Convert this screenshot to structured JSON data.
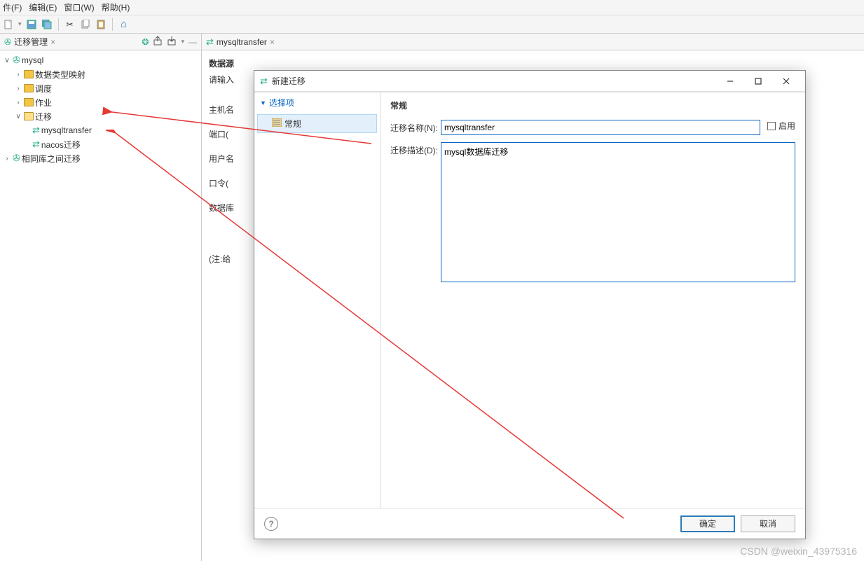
{
  "menubar": {
    "file": "件(F)",
    "edit": "编辑(E)",
    "window": "窗口(W)",
    "help": "帮助(H)"
  },
  "left_panel": {
    "tab_title": "迁移管理",
    "tree": {
      "root": "mysql",
      "items": [
        "数据类型映射",
        "调度",
        "作业",
        "迁移"
      ],
      "migration_children": [
        "mysqltransfer",
        "nacos迁移"
      ],
      "sibling": "相同库之间迁移"
    }
  },
  "editor": {
    "tab_title": "mysqltransfer",
    "section": "数据源",
    "prompt": "请输入",
    "labels": {
      "host": "主机名",
      "port": "端口(",
      "user": "用户名",
      "pass": "口令(",
      "db": "数据库",
      "note": "(注:给"
    }
  },
  "dialog": {
    "title": "新建迁移",
    "left": {
      "header": "选择项",
      "item": "常规"
    },
    "right": {
      "title": "常规",
      "name_label": "迁移名称(N):",
      "name_value": "mysqltransfer",
      "enable_label": "启用",
      "desc_label": "迁移描述(D):",
      "desc_value": "mysql数据库迁移"
    },
    "buttons": {
      "ok": "确定",
      "cancel": "取消"
    }
  },
  "watermark": "CSDN @weixin_43975316"
}
